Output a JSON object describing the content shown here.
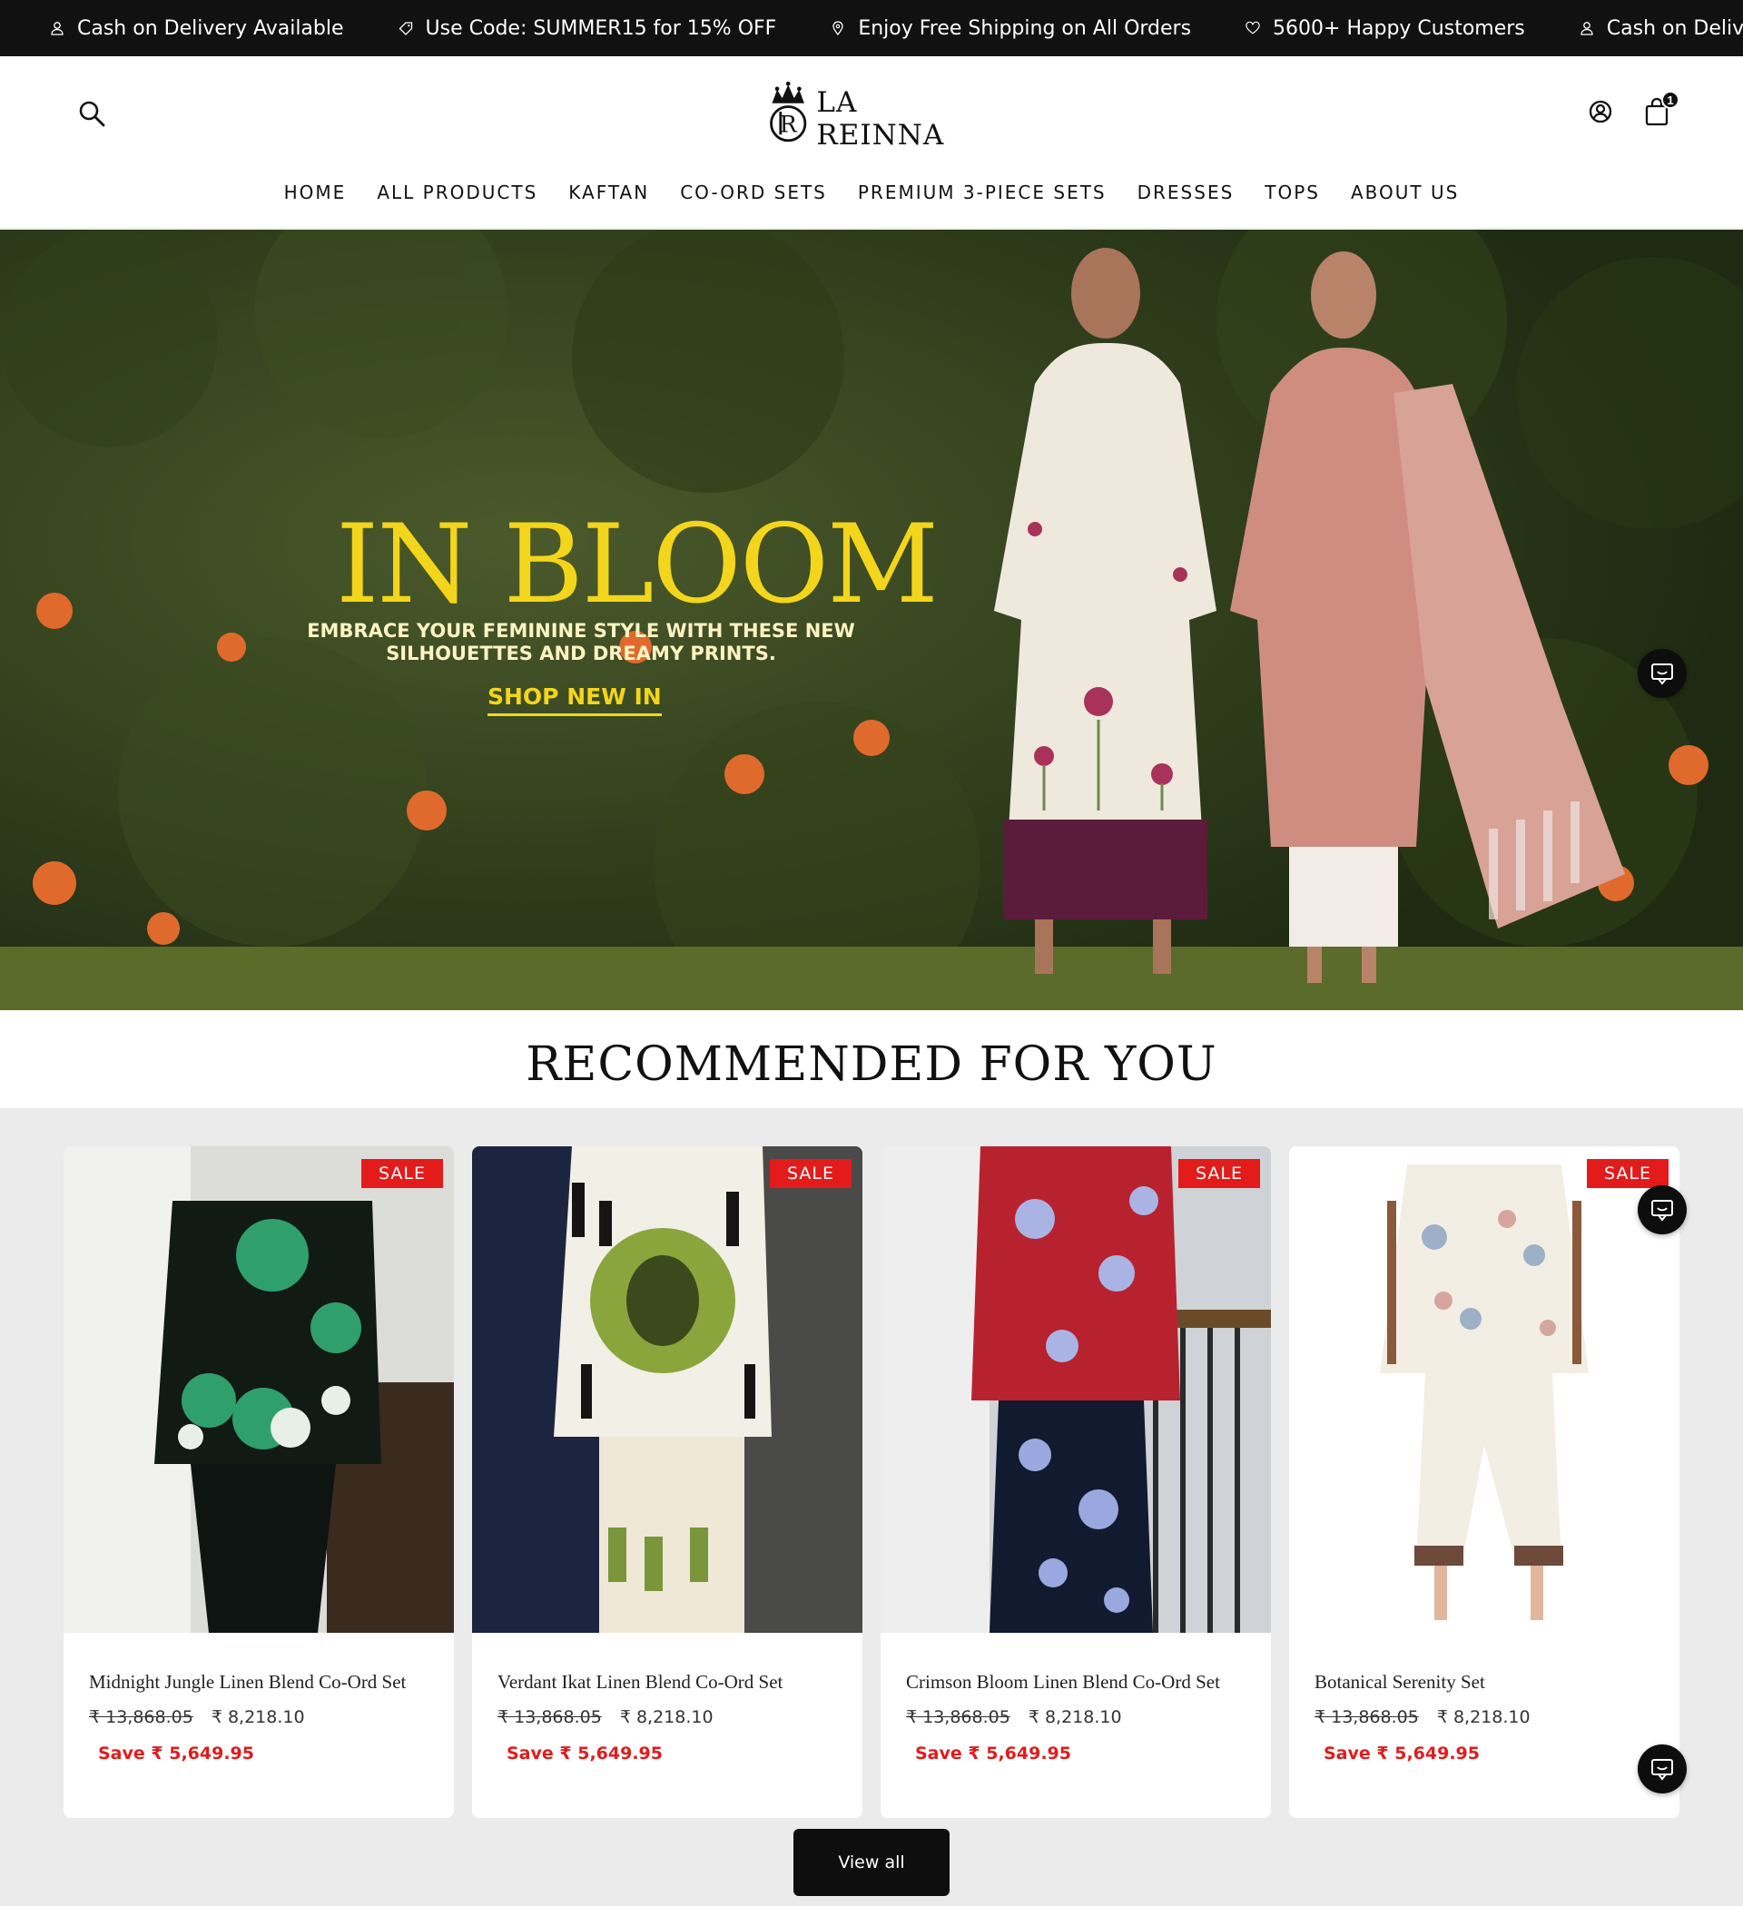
{
  "announcement": {
    "items": [
      {
        "icon": "user-icon",
        "text": "Cash on Delivery Available"
      },
      {
        "icon": "tag-icon",
        "text": "Use Code: SUMMER15 for 15% OFF"
      },
      {
        "icon": "location-pin-icon",
        "text": "Enjoy Free Shipping on All Orders"
      },
      {
        "icon": "heart-icon",
        "text": "5600+ Happy Customers"
      },
      {
        "icon": "user-icon",
        "text": "Cash on Delivery Available"
      }
    ]
  },
  "header": {
    "brand": "LA REINNA",
    "cart_count": "1"
  },
  "nav": {
    "items": [
      "HOME",
      "ALL PRODUCTS",
      "KAFTAN",
      "CO-ORD SETS",
      "PREMIUM 3-PIECE SETS",
      "DRESSES",
      "TOPS",
      "ABOUT US"
    ]
  },
  "hero": {
    "title": "IN BLOOM",
    "subtitle_line1": "EMBRACE YOUR FEMININE STYLE WITH THESE NEW",
    "subtitle_line2": "SILHOUETTES AND DREAMY PRINTS.",
    "cta": "SHOP NEW IN"
  },
  "recommended": {
    "title": "RECOMMENDED FOR YOU",
    "view_all": "View all",
    "products": [
      {
        "name": "Midnight Jungle Linen Blend Co-Ord Set",
        "badge": "SALE",
        "old_price": "₹ 13,868.05",
        "price": "₹ 8,218.10",
        "save": "Save ₹ 5,649.95"
      },
      {
        "name": "Verdant Ikat Linen Blend Co-Ord Set",
        "badge": "SALE",
        "old_price": "₹ 13,868.05",
        "price": "₹ 8,218.10",
        "save": "Save ₹ 5,649.95"
      },
      {
        "name": "Crimson Bloom Linen Blend Co-Ord Set",
        "badge": "SALE",
        "old_price": "₹ 13,868.05",
        "price": "₹ 8,218.10",
        "save": "Save ₹ 5,649.95"
      },
      {
        "name": "Botanical Serenity Set",
        "badge": "SALE",
        "old_price": "₹ 13,868.05",
        "price": "₹ 8,218.10",
        "save": "Save ₹ 5,649.95"
      }
    ]
  },
  "colors": {
    "announcement_bg": "#111111",
    "hero_title": "#f3d51b",
    "sale_red": "#e31b1b",
    "section_bg": "#ebebeb"
  }
}
